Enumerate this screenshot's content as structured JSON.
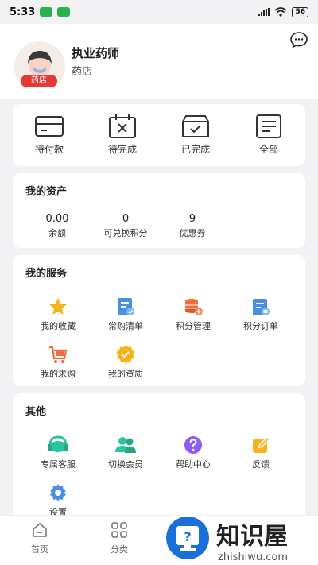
{
  "status": {
    "time": "5:33",
    "battery": "56"
  },
  "profile": {
    "name": "执业药师",
    "role": "药店",
    "badge": "药店"
  },
  "orders": [
    {
      "label": "待付款",
      "icon": "wallet-icon"
    },
    {
      "label": "待完成",
      "icon": "calendar-x-icon"
    },
    {
      "label": "已完成",
      "icon": "box-check-icon"
    },
    {
      "label": "全部",
      "icon": "document-list-icon"
    }
  ],
  "assets": {
    "title": "我的资产",
    "items": [
      {
        "value": "0.00",
        "label": "余额"
      },
      {
        "value": "0",
        "label": "可兑换积分"
      },
      {
        "value": "9",
        "label": "优惠券"
      }
    ]
  },
  "services": {
    "title": "我的服务",
    "items": [
      {
        "label": "我的收藏",
        "icon": "star-icon"
      },
      {
        "label": "常购清单",
        "icon": "checklist-icon"
      },
      {
        "label": "积分管理",
        "icon": "coins-icon"
      },
      {
        "label": "积分订单",
        "icon": "order-icon"
      },
      {
        "label": "我的求购",
        "icon": "cart-icon"
      },
      {
        "label": "我的资质",
        "icon": "certificate-icon"
      }
    ]
  },
  "other": {
    "title": "其他",
    "items": [
      {
        "label": "专属客服",
        "icon": "headset-icon"
      },
      {
        "label": "切换会员",
        "icon": "users-icon"
      },
      {
        "label": "帮助中心",
        "icon": "help-icon"
      },
      {
        "label": "反馈",
        "icon": "feedback-icon"
      },
      {
        "label": "设置",
        "icon": "settings-icon"
      }
    ]
  },
  "tabs": [
    {
      "label": "首页",
      "icon": "home-icon"
    },
    {
      "label": "分类",
      "icon": "category-icon"
    }
  ],
  "watermark": {
    "brand": "知识屋",
    "domain": "zhishiwu.com"
  }
}
